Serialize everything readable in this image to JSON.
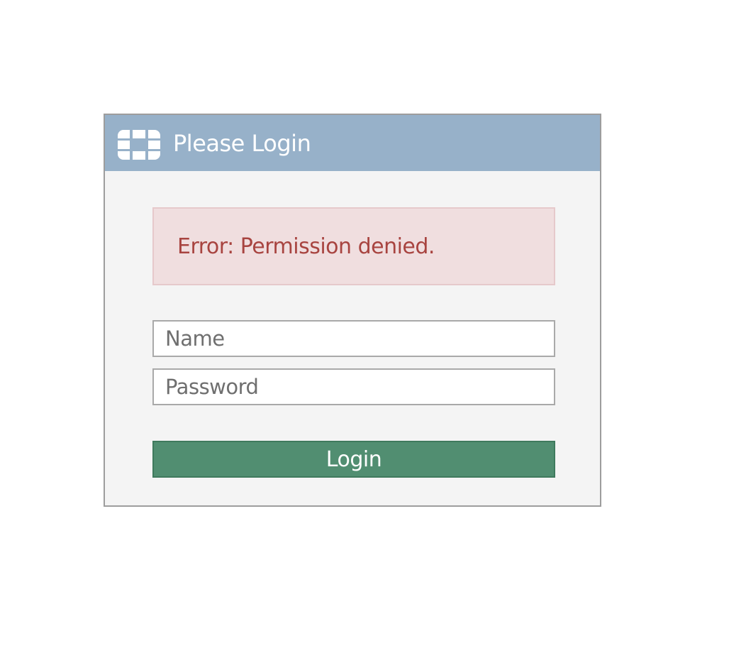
{
  "header": {
    "title": "Please Login",
    "logo_icon": "brand-logo-icon"
  },
  "error": {
    "message": "Error: Permission denied."
  },
  "form": {
    "name_placeholder": "Name",
    "password_placeholder": "Password",
    "login_label": "Login"
  },
  "colors": {
    "header_bg": "#97b1c9",
    "error_bg": "#f0dedf",
    "error_text": "#a84440",
    "button_bg": "#518e71"
  }
}
